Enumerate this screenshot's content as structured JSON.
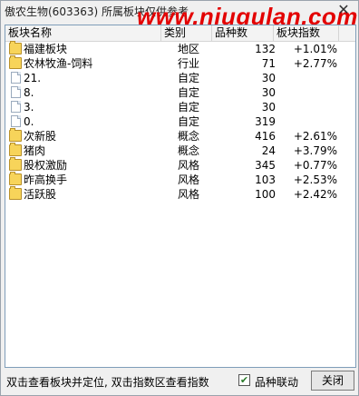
{
  "window": {
    "title": "傲农生物(603363)  所属板块仅供参考",
    "watermark": "www.niugulan.com",
    "close_glyph": "✕"
  },
  "table": {
    "headers": [
      "板块名称",
      "类别",
      "品种数",
      "板块指数"
    ],
    "rows": [
      {
        "icon": "folder",
        "name": "福建板块",
        "type": "地区",
        "count": "132",
        "index": "+1.01%"
      },
      {
        "icon": "folder",
        "name": "农林牧渔-饲料",
        "type": "行业",
        "count": "71",
        "index": "+2.77%"
      },
      {
        "icon": "doc",
        "name": "21.",
        "type": "自定",
        "count": "30",
        "index": ""
      },
      {
        "icon": "doc",
        "name": "8.",
        "type": "自定",
        "count": "30",
        "index": ""
      },
      {
        "icon": "doc",
        "name": "3.",
        "type": "自定",
        "count": "30",
        "index": ""
      },
      {
        "icon": "doc",
        "name": "0.",
        "type": "自定",
        "count": "319",
        "index": ""
      },
      {
        "icon": "folder",
        "name": "次新股",
        "type": "概念",
        "count": "416",
        "index": "+2.61%"
      },
      {
        "icon": "folder",
        "name": "猪肉",
        "type": "概念",
        "count": "24",
        "index": "+3.79%"
      },
      {
        "icon": "folder",
        "name": "股权激励",
        "type": "风格",
        "count": "345",
        "index": "+0.77%"
      },
      {
        "icon": "folder",
        "name": "昨高换手",
        "type": "风格",
        "count": "103",
        "index": "+2.53%"
      },
      {
        "icon": "folder",
        "name": "活跃股",
        "type": "风格",
        "count": "100",
        "index": "+2.42%"
      }
    ]
  },
  "footer": {
    "hint": "双击查看板块并定位, 双击指数区查看指数",
    "checkbox_label": "品种联动",
    "checkbox_checked": true,
    "checkbox_glyph": "✔",
    "close_button": "关闭"
  }
}
